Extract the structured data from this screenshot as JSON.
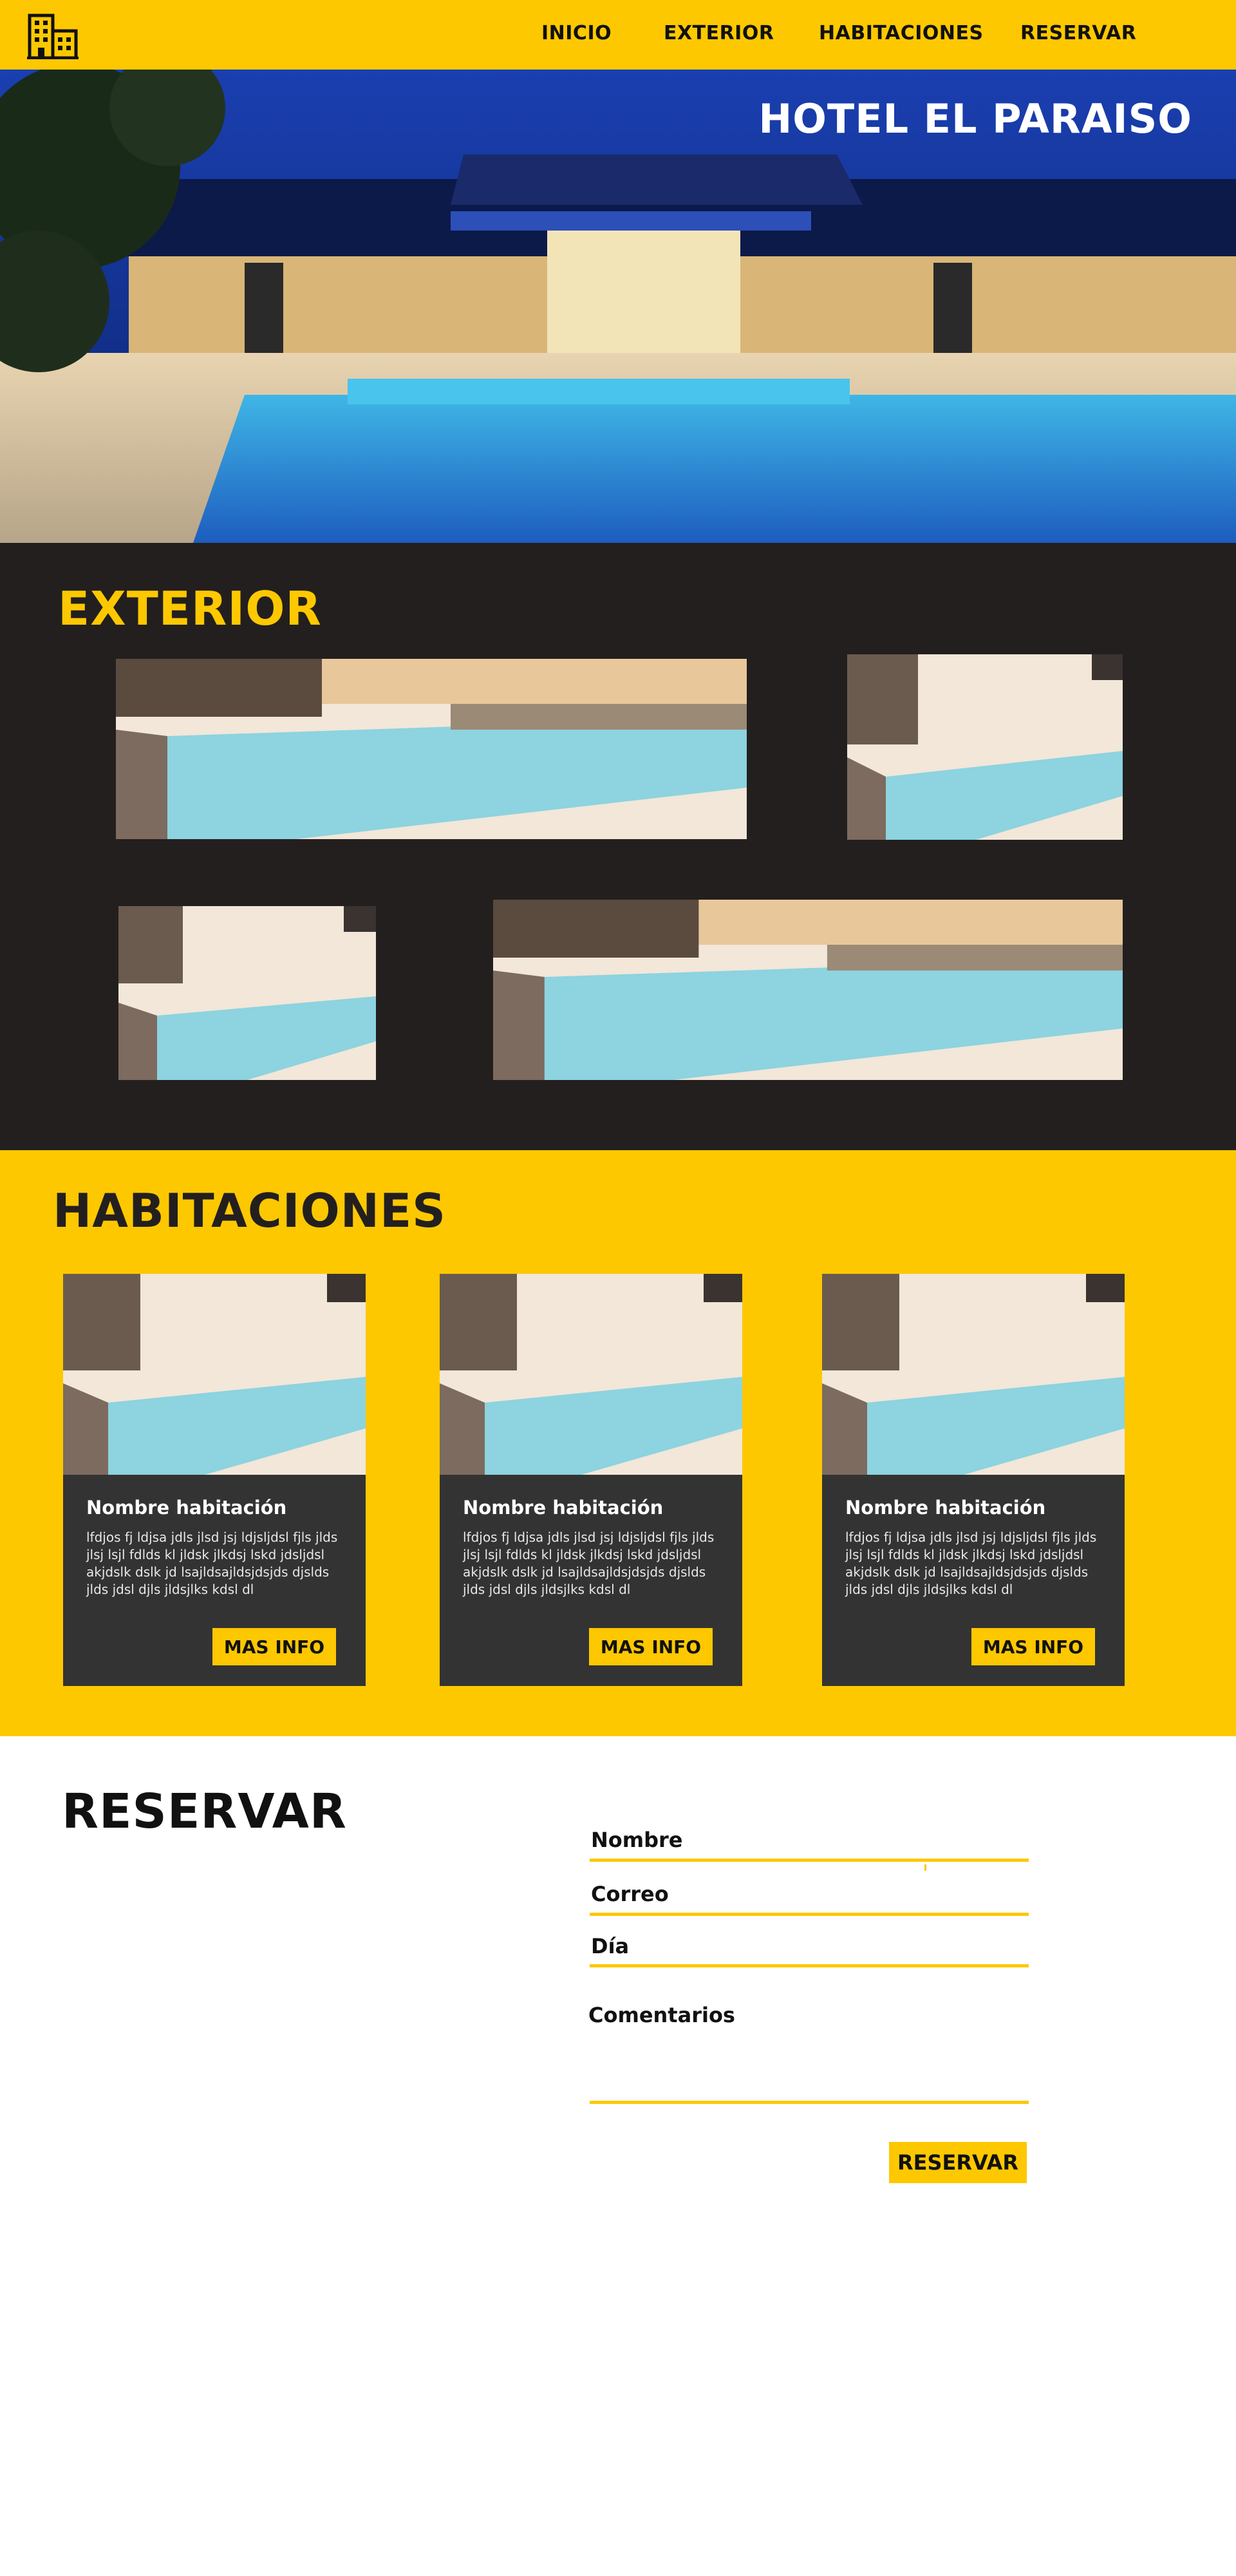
{
  "header": {
    "nav": [
      {
        "label": "INICIO"
      },
      {
        "label": "EXTERIOR"
      },
      {
        "label": "HABITACIONES"
      },
      {
        "label": "RESERVAR"
      }
    ],
    "logo_icon": "hotel-building-icon"
  },
  "hero": {
    "title": "HOTEL EL PARAISO"
  },
  "exterior": {
    "title": "EXTERIOR"
  },
  "rooms": {
    "title": "HABITACIONES",
    "cards": [
      {
        "name": "Nombre habitación",
        "description": "lfdjos fj ldjsa jdls jlsd jsj ldjsljdsl fjls jlds jlsj lsjl fdlds kl jldsk jlkdsj lskd jdsljdsl akjdslk dslk jd lsajldsajldsjdsjds djslds jlds jdsl djls jldsjlks kdsl dl",
        "button": "MAS INFO"
      },
      {
        "name": "Nombre habitación",
        "description": "lfdjos fj ldjsa jdls jlsd jsj ldjsljdsl fjls jlds jlsj lsjl fdlds kl jldsk jlkdsj lskd jdsljdsl akjdslk dslk jd lsajldsajldsjdsjds djslds jlds jdsl djls jldsjlks kdsl dl",
        "button": "MAS INFO"
      },
      {
        "name": "Nombre habitación",
        "description": "lfdjos fj ldjsa jdls jlsd jsj ldjsljdsl fjls jlds jlsj lsjl fdlds kl jldsk jlkdsj lskd jdsljdsl akjdslk dslk jd lsajldsajldsjdsjds djslds jlds jdsl djls jldsjlks kdsl dl",
        "button": "MAS INFO"
      }
    ]
  },
  "reservar": {
    "title": "RESERVAR",
    "fields": {
      "name_label": "Nombre",
      "email_label": "Correo",
      "day_label": "Día",
      "comments_label": "Comentarios"
    },
    "submit": "RESERVAR"
  },
  "colors": {
    "brand_yellow": "#fdc800",
    "dark": "#231f1f",
    "card": "#333333"
  }
}
